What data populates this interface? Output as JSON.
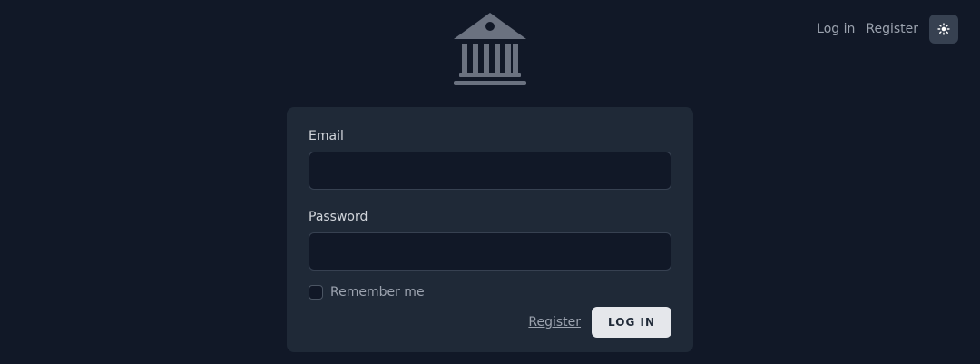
{
  "header": {
    "nav": {
      "login_label": "Log in",
      "register_label": "Register"
    },
    "theme_toggle_icon": "sun-icon",
    "logo_icon": "bank-icon"
  },
  "form": {
    "email": {
      "label": "Email",
      "value": "",
      "placeholder": ""
    },
    "password": {
      "label": "Password",
      "value": "",
      "placeholder": ""
    },
    "remember": {
      "label": "Remember me",
      "checked": false
    },
    "actions": {
      "register_label": "Register",
      "login_label": "LOG IN"
    }
  },
  "colors": {
    "background": "#111827",
    "card": "#1f2937",
    "input_background": "#111827",
    "text": "#d1d5db",
    "muted_text": "#9ca3af",
    "button": "#e5e7eb",
    "icon": "#6b7280"
  }
}
